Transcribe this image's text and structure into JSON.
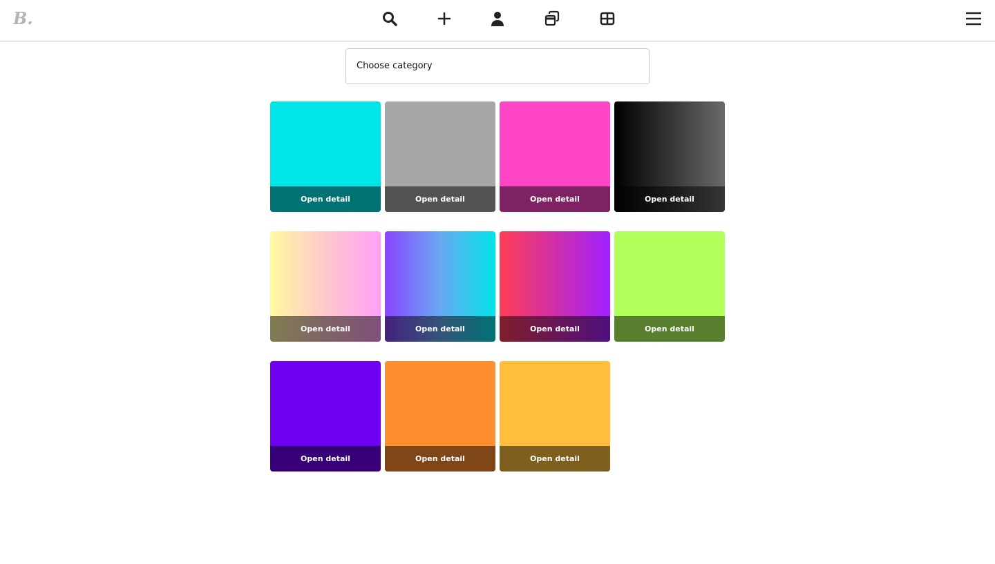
{
  "header": {
    "logo": "B.",
    "nav": [
      "search-icon",
      "plus-icon",
      "user-icon",
      "windows-icon",
      "grid-icon"
    ],
    "menu": "hamburger-icon"
  },
  "filter": {
    "placeholder": "Choose category"
  },
  "cards": [
    {
      "label": "Open detail",
      "background": "#00e5e8"
    },
    {
      "label": "Open detail",
      "background": "#a6a6a6"
    },
    {
      "label": "Open detail",
      "background": "#ff45c6"
    },
    {
      "label": "Open detail",
      "background": "linear-gradient(90deg,#000,#6a6a6a)"
    },
    {
      "label": "Open detail",
      "background": "linear-gradient(90deg,#fffaa0,#ffc8cc,#ffa0f8)"
    },
    {
      "label": "Open detail",
      "background": "linear-gradient(90deg,#8b45ff,#68a8f2,#00e5e8)"
    },
    {
      "label": "Open detail",
      "background": "linear-gradient(90deg,#ff3e55,#a020ff)"
    },
    {
      "label": "Open detail",
      "background": "#b0ff5a"
    },
    {
      "label": "Open detail",
      "background": "#6f00f2"
    },
    {
      "label": "Open detail",
      "background": "#ff8e30"
    },
    {
      "label": "Open detail",
      "background": "#ffbe3c"
    }
  ]
}
